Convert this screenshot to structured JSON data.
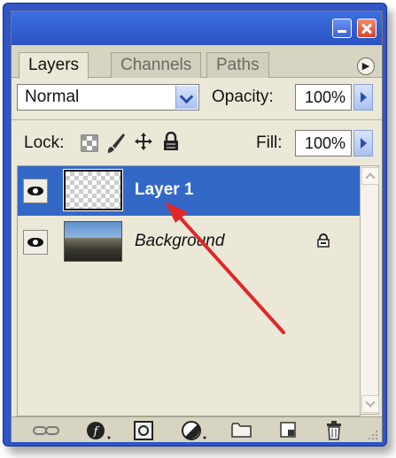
{
  "tabs": [
    {
      "label": "Layers",
      "active": true
    },
    {
      "label": "Channels",
      "active": false
    },
    {
      "label": "Paths",
      "active": false
    }
  ],
  "blend_mode": "Normal",
  "opacity": {
    "label": "Opacity:",
    "value": "100%"
  },
  "lock": {
    "label": "Lock:"
  },
  "fill": {
    "label": "Fill:",
    "value": "100%"
  },
  "layers": [
    {
      "name": "Layer 1",
      "selected": true,
      "visible": true,
      "thumbnail": "transparent-checkerboard"
    },
    {
      "name": "Background",
      "selected": false,
      "visible": true,
      "locked": true,
      "thumbnail": "road-photo"
    }
  ],
  "bottom_icons": [
    "link-layers-icon",
    "layer-style-icon",
    "layer-mask-icon",
    "adjustment-layer-icon",
    "new-group-icon",
    "new-layer-icon",
    "delete-layer-icon"
  ],
  "colors": {
    "title_blue": "#2f55c8",
    "selection_blue": "#3468c7",
    "panel_bg": "#ebe8d8",
    "annotation_arrow": "#e02828"
  }
}
